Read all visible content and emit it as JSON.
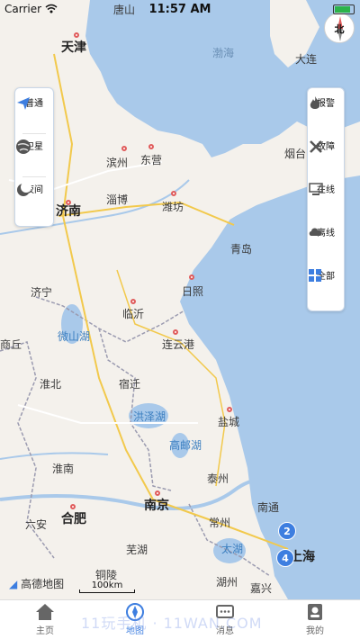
{
  "status_bar": {
    "carrier": "Carrier",
    "time": "11:57 AM",
    "battery_level": 0.85
  },
  "map": {
    "cities": [
      {
        "name": "天津",
        "class": "big"
      },
      {
        "name": "唐山",
        "class": ""
      },
      {
        "name": "渤海",
        "class": "sea"
      },
      {
        "name": "大连",
        "class": ""
      },
      {
        "name": "滨州",
        "class": ""
      },
      {
        "name": "东营",
        "class": ""
      },
      {
        "name": "烟台",
        "class": ""
      },
      {
        "name": "淄博",
        "class": ""
      },
      {
        "name": "潍坊",
        "class": ""
      },
      {
        "name": "济南",
        "class": "big"
      },
      {
        "name": "青岛",
        "class": ""
      },
      {
        "name": "济宁",
        "class": ""
      },
      {
        "name": "日照",
        "class": ""
      },
      {
        "name": "临沂",
        "class": ""
      },
      {
        "name": "微山湖",
        "class": "lake"
      },
      {
        "name": "连云港",
        "class": ""
      },
      {
        "name": "商丘",
        "class": ""
      },
      {
        "name": "淮北",
        "class": ""
      },
      {
        "name": "宿迁",
        "class": ""
      },
      {
        "name": "洪泽湖",
        "class": "lake"
      },
      {
        "name": "盐城",
        "class": ""
      },
      {
        "name": "高邮湖",
        "class": "lake"
      },
      {
        "name": "淮南",
        "class": ""
      },
      {
        "name": "泰州",
        "class": ""
      },
      {
        "name": "南京",
        "class": "big"
      },
      {
        "name": "南通",
        "class": ""
      },
      {
        "name": "合肥",
        "class": "big"
      },
      {
        "name": "六安",
        "class": ""
      },
      {
        "name": "常州",
        "class": ""
      },
      {
        "name": "芜湖",
        "class": ""
      },
      {
        "name": "太湖",
        "class": "lake"
      },
      {
        "name": "上海",
        "class": "big"
      },
      {
        "name": "铜陵",
        "class": ""
      },
      {
        "name": "湖州",
        "class": ""
      },
      {
        "name": "嘉兴",
        "class": ""
      }
    ],
    "clusters": [
      "2",
      "4"
    ],
    "scale_label": "100km",
    "logo_text": "高德地图",
    "compass_label": "北"
  },
  "left_panel": {
    "items": [
      {
        "label": "普通",
        "icon": "navigation-arrow-icon"
      },
      {
        "label": "卫星",
        "icon": "globe-icon"
      },
      {
        "label": "夜间",
        "icon": "moon-icon"
      }
    ]
  },
  "right_panel": {
    "items": [
      {
        "label": "报警",
        "icon": "flame-icon"
      },
      {
        "label": "故障",
        "icon": "tools-icon"
      },
      {
        "label": "在线",
        "icon": "monitor-icon"
      },
      {
        "label": "离线",
        "icon": "cloud-icon"
      },
      {
        "label": "全部",
        "icon": "grid-icon"
      }
    ]
  },
  "tab_bar": {
    "tabs": [
      {
        "label": "主页",
        "icon": "home-icon"
      },
      {
        "label": "地图",
        "icon": "compass-icon",
        "active": true
      },
      {
        "label": "消息",
        "icon": "message-icon"
      },
      {
        "label": "我的",
        "icon": "profile-icon"
      }
    ]
  },
  "watermark": "11玩手机 · 11WAN.COM",
  "colors": {
    "sea": "#a9c9ea",
    "land": "#f4f1ec",
    "accent": "#3d7ee0",
    "alarm": "#e05b5b",
    "battery": "#2bb34a"
  }
}
